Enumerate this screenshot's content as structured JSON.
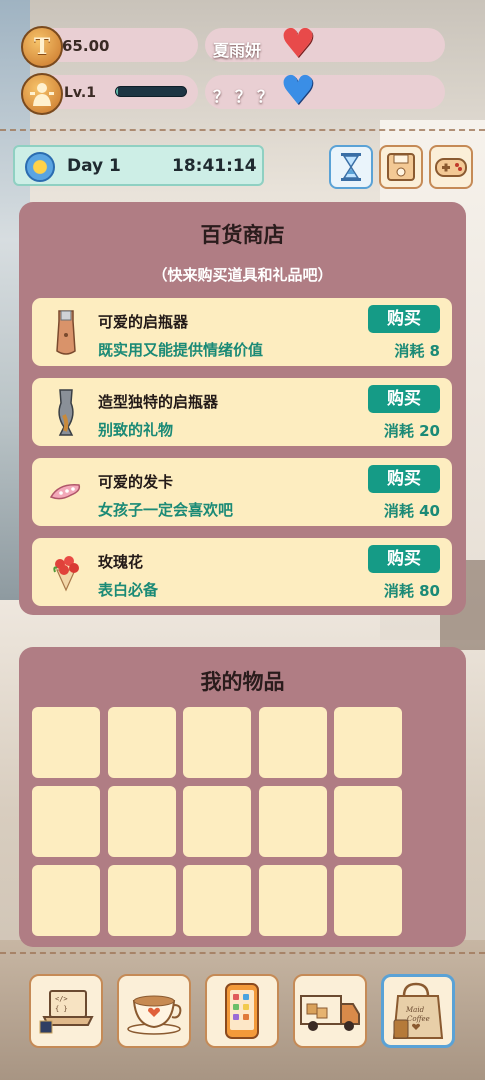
{
  "player": {
    "money": "65.00",
    "level": "Lv.1",
    "xp_progress": 0.03
  },
  "npcs": [
    {
      "name": "夏雨妍",
      "heart_color": "#e84a4a"
    },
    {
      "name": "？？？",
      "heart_color": "#3a8ee6"
    }
  ],
  "time": {
    "day": "Day 1",
    "clock": "18:41:14"
  },
  "tools": [
    {
      "icon": "hourglass-icon"
    },
    {
      "icon": "save-icon"
    },
    {
      "icon": "gamepad-icon"
    }
  ],
  "shop": {
    "title": "百货商店",
    "subtitle": "（快来购买道具和礼品吧）",
    "buy_label": "购买",
    "items": [
      {
        "icon": "bottle-opener-icon",
        "name": "可爱的启瓶器",
        "desc": "既实用又能提供情绪价值",
        "cost": "消耗 8"
      },
      {
        "icon": "fish-bottle-opener-icon",
        "name": "造型独特的启瓶器",
        "desc": "别致的礼物",
        "cost": "消耗 20"
      },
      {
        "icon": "hair-clip-icon",
        "name": "可爱的发卡",
        "desc": "女孩子一定会喜欢吧",
        "cost": "消耗 40"
      },
      {
        "icon": "rose-bouquet-icon",
        "name": "玫瑰花",
        "desc": "表白必备",
        "cost": "消耗 80"
      }
    ]
  },
  "inventory": {
    "title": "我的物品",
    "slot_count": 15
  },
  "nav": [
    {
      "icon": "laptop-code-icon"
    },
    {
      "icon": "coffee-cup-icon"
    },
    {
      "icon": "phone-icon"
    },
    {
      "icon": "moving-truck-icon"
    },
    {
      "icon": "shopping-bag-icon",
      "active": true
    }
  ],
  "colors": {
    "panel": "#b07d84",
    "card": "#fdedc0",
    "accent": "#159b86"
  }
}
